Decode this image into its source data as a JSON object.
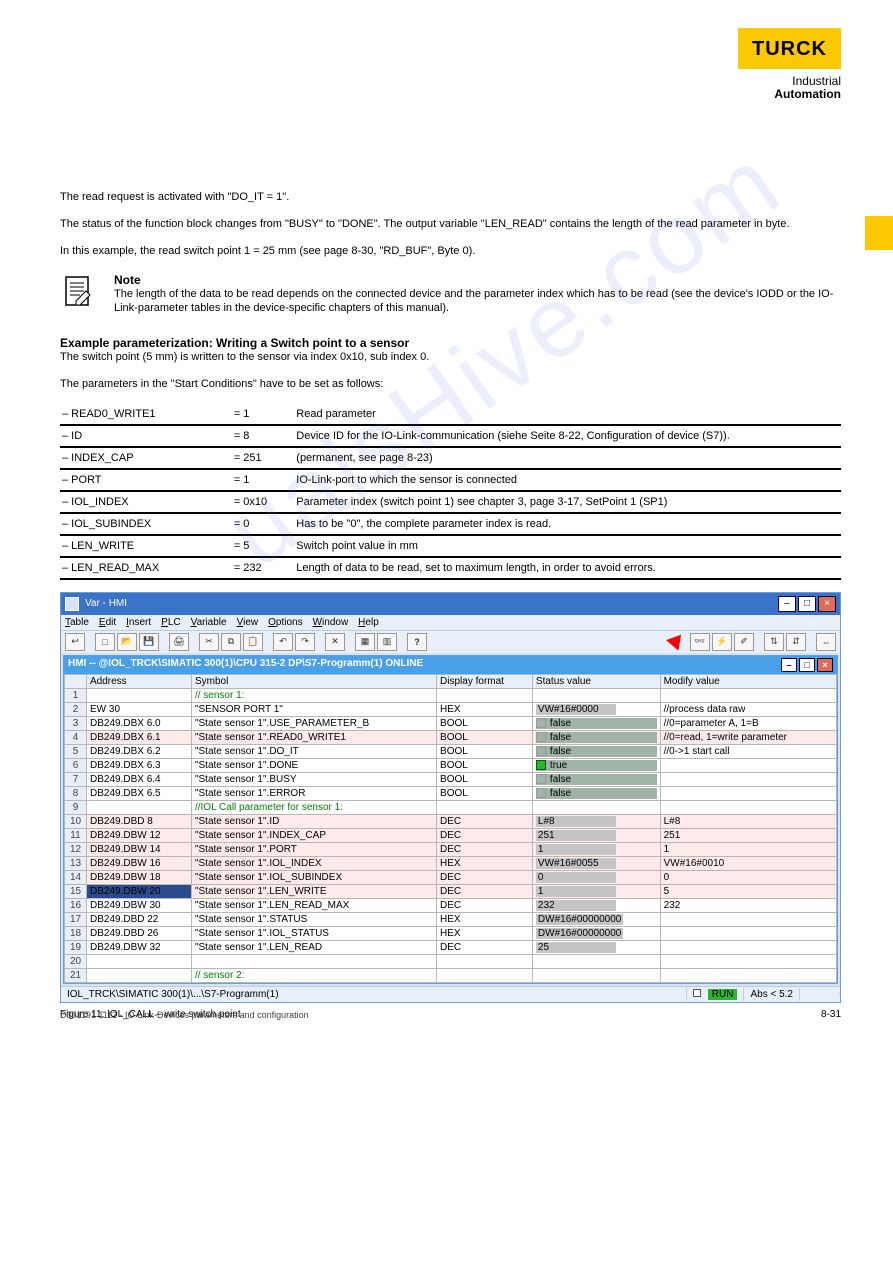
{
  "brand": {
    "name": "TURCK",
    "tagline1": "Industrial",
    "tagline2": "Automation"
  },
  "intro_p1": "The read request is activated with \"DO_IT = 1\".",
  "intro_p2": "The status of the function block changes from \"BUSY\" to \"DONE\". The output variable \"LEN_READ\" contains the length of the read parameter in byte.",
  "intro_p3": "In this example, the read switch point 1 = 25 mm (see page 8-30, \"RD_BUF\", Byte 0).",
  "note_label": "Note",
  "note_body": "The length of the data to be read depends on the connected device and the parameter index which has to be read (see the device's IODD or the IO-Link-parameter tables in the device-specific chapters of this manual).",
  "example_label": "Example parameterization: Writing a Switch point to a sensor",
  "example_p1": "The switch point (5 mm) is written to the sensor via index 0x10, sub index 0.",
  "example_p2": "The parameters in the \"Start Conditions\" have to be set as follows:",
  "params": [
    {
      "k": "READ0_WRITE1",
      "v": "= 1",
      "d": "Read parameter"
    },
    {
      "k": "ID",
      "v": "= 8",
      "d": "Device ID for the IO-Link-communication (siehe Seite 8-22, Configuration of device (S7))."
    },
    {
      "k": "INDEX_CAP",
      "v": "= 251",
      "d": "(permanent, see page 8-23)"
    },
    {
      "k": "PORT",
      "v": "= 1",
      "d": "IO-Link-port to which the sensor is connected"
    },
    {
      "k": "IOL_INDEX",
      "v": "= 0x10",
      "d": "Parameter index (switch point 1) see chapter 3, page 3-17, SetPoint 1 (SP1)"
    },
    {
      "k": "IOL_SUBINDEX",
      "v": "= 0",
      "d": "Has to be \"0\", the complete parameter index is read."
    },
    {
      "k": "LEN_WRITE",
      "v": "= 5",
      "d": "Switch point value in mm"
    },
    {
      "k": "LEN_READ_MAX",
      "v": "= 232",
      "d": "Length of data to be read, set to maximum length, in order to avoid errors."
    }
  ],
  "fig_caption": "Figure 11: IOL_CALL – write switch point",
  "window": {
    "title": "Var - HMI",
    "menu": [
      "Table",
      "Edit",
      "Insert",
      "PLC",
      "Variable",
      "View",
      "Options",
      "Window",
      "Help"
    ],
    "inner_title": "HMI -- @IOL_TRCK\\SIMATIC 300(1)\\CPU 315-2 DP\\S7-Programm(1)  ONLINE",
    "columns": [
      "",
      "Address",
      "Symbol",
      "Display format",
      "Status value",
      "Modify value"
    ],
    "rows": [
      {
        "n": "1",
        "type": "comment",
        "addr": "",
        "sym": "// sensor 1:",
        "fmt": "",
        "sv": "",
        "mv": ""
      },
      {
        "n": "2",
        "type": "plain",
        "addr": "EW    30",
        "sym": "\"SENSOR PORT 1\"",
        "fmt": "HEX",
        "sv": "VW#16#0000",
        "mv": "//process data raw",
        "svstyle": "gray"
      },
      {
        "n": "3",
        "type": "plain",
        "addr": "DB249.DBX   6.0",
        "sym": "\"State sensor 1\".USE_PARAMETER_B",
        "fmt": "BOOL",
        "sv": "false",
        "mv": "//0=parameter A, 1=B",
        "svstyle": "false"
      },
      {
        "n": "4",
        "type": "hlred",
        "addr": "DB249.DBX   6.1",
        "sym": "\"State sensor 1\".READ0_WRITE1",
        "fmt": "BOOL",
        "sv": "false",
        "mv": "//0=read, 1=write parameter",
        "svstyle": "false"
      },
      {
        "n": "5",
        "type": "plain",
        "addr": "DB249.DBX   6.2",
        "sym": "\"State sensor 1\".DO_IT",
        "fmt": "BOOL",
        "sv": "false",
        "mv": "//0->1 start call",
        "svstyle": "false"
      },
      {
        "n": "6",
        "type": "plain",
        "addr": "DB249.DBX   6.3",
        "sym": "\"State sensor 1\".DONE",
        "fmt": "BOOL",
        "sv": "true",
        "mv": "",
        "svstyle": "true"
      },
      {
        "n": "7",
        "type": "plain",
        "addr": "DB249.DBX   6.4",
        "sym": "\"State sensor 1\".BUSY",
        "fmt": "BOOL",
        "sv": "false",
        "mv": "",
        "svstyle": "false"
      },
      {
        "n": "8",
        "type": "plain",
        "addr": "DB249.DBX   6.5",
        "sym": "\"State sensor 1\".ERROR",
        "fmt": "BOOL",
        "sv": "false",
        "mv": "",
        "svstyle": "false"
      },
      {
        "n": "9",
        "type": "comment",
        "addr": "",
        "sym": "//IOL Call parameter for sensor 1:",
        "fmt": "",
        "sv": "",
        "mv": ""
      },
      {
        "n": "10",
        "type": "hlred",
        "addr": "DB249.DBD   8",
        "sym": "\"State sensor 1\".ID",
        "fmt": "DEC",
        "sv": "L#8",
        "mv": "L#8",
        "svstyle": "gray"
      },
      {
        "n": "11",
        "type": "hlred",
        "addr": "DB249.DBW  12",
        "sym": "\"State sensor 1\".INDEX_CAP",
        "fmt": "DEC",
        "sv": "251",
        "mv": "251",
        "svstyle": "gray"
      },
      {
        "n": "12",
        "type": "hlred",
        "addr": "DB249.DBW  14",
        "sym": "\"State sensor 1\".PORT",
        "fmt": "DEC",
        "sv": "1",
        "mv": "1",
        "svstyle": "gray"
      },
      {
        "n": "13",
        "type": "hlred",
        "addr": "DB249.DBW  16",
        "sym": "\"State sensor 1\".IOL_INDEX",
        "fmt": "HEX",
        "sv": "VW#16#0055",
        "mv": "VW#16#0010",
        "svstyle": "gray"
      },
      {
        "n": "14",
        "type": "hlred",
        "addr": "DB249.DBW  18",
        "sym": "\"State sensor 1\".IOL_SUBINDEX",
        "fmt": "DEC",
        "sv": "0",
        "mv": "0",
        "svstyle": "gray"
      },
      {
        "n": "15",
        "type": "sel hlred",
        "addr": "DB249.DBW  20",
        "sym": "\"State sensor 1\".LEN_WRITE",
        "fmt": "DEC",
        "sv": "1",
        "mv": "5",
        "svstyle": "gray"
      },
      {
        "n": "16",
        "type": "plain",
        "addr": "DB249.DBW  30",
        "sym": "\"State sensor 1\".LEN_READ_MAX",
        "fmt": "DEC",
        "sv": "232",
        "mv": "232",
        "svstyle": "gray"
      },
      {
        "n": "17",
        "type": "plain",
        "addr": "DB249.DBD  22",
        "sym": "\"State sensor 1\".STATUS",
        "fmt": "HEX",
        "sv": "DW#16#00000000",
        "mv": "",
        "svstyle": "gray"
      },
      {
        "n": "18",
        "type": "plain",
        "addr": "DB249.DBD  26",
        "sym": "\"State sensor 1\".IOL_STATUS",
        "fmt": "HEX",
        "sv": "DW#16#00000000",
        "mv": "",
        "svstyle": "gray"
      },
      {
        "n": "19",
        "type": "plain",
        "addr": "DB249.DBW  32",
        "sym": "\"State sensor 1\".LEN_READ",
        "fmt": "DEC",
        "sv": "25",
        "mv": "",
        "svstyle": "gray"
      },
      {
        "n": "20",
        "type": "plain",
        "addr": "",
        "sym": "",
        "fmt": "",
        "sv": "",
        "mv": ""
      },
      {
        "n": "21",
        "type": "comment",
        "addr": "",
        "sym": "// sensor 2:",
        "fmt": "",
        "sv": "",
        "mv": ""
      }
    ],
    "status_path": "IOL_TRCK\\SIMATIC 300(1)\\...\\S7-Programm(1)",
    "status_run": "RUN",
    "status_abs": "Abs < 5.2"
  },
  "footer": {
    "doc_id": "D301191 1112 - IO-Link-Devices parameters and configuration",
    "page": "8-31"
  }
}
